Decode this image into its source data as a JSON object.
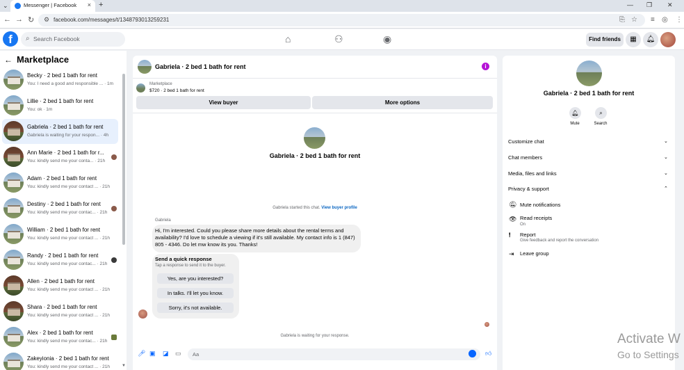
{
  "browser": {
    "tab_title": "Messenger | Facebook",
    "url": "facebook.com/messages/t/1348793013259231"
  },
  "fb_nav": {
    "search_placeholder": "Search Facebook",
    "find_friends": "Find friends"
  },
  "sidebar": {
    "title": "Marketplace",
    "conversations": [
      {
        "name": "Becky · 2 bed 1 bath for rent",
        "preview": "You: I need a good and responsible ...",
        "time": "· 1m"
      },
      {
        "name": "Lillie · 2 bed 1 bath for rent",
        "preview": "You: ok",
        "time": "· 1m"
      },
      {
        "name": "Gabriela · 2 bed 1 bath for rent",
        "preview": "Gabriela is waiting for your respon...",
        "time": "· 4h"
      },
      {
        "name": "Ann Marie · 2 bed 1 bath for r...",
        "preview": "You: kindly send me your conta...",
        "time": "· 21h"
      },
      {
        "name": "Adam · 2 bed 1 bath for rent",
        "preview": "You: kindly send me your contact ...",
        "time": "· 21h"
      },
      {
        "name": "Destiny · 2 bed 1 bath for rent",
        "preview": "You: kindly send me your contac...",
        "time": "· 21h"
      },
      {
        "name": "William · 2 bed 1 bath for rent",
        "preview": "You: kindly send me your contact ...",
        "time": "· 21h"
      },
      {
        "name": "Randy · 2 bed 1 bath for rent",
        "preview": "You: kindly send me your contac...",
        "time": "· 21h"
      },
      {
        "name": "Allen · 2 bed 1 bath for rent",
        "preview": "You: kindly send me your contact ...",
        "time": "· 21h"
      },
      {
        "name": "Shara · 2 bed 1 bath for rent",
        "preview": "You: kindly send me your contact ...",
        "time": "· 21h"
      },
      {
        "name": "Alex · 2 bed 1 bath for rent",
        "preview": "You: kindly send me your contac...",
        "time": "· 21h"
      },
      {
        "name": "Zakeyionia · 2 bed 1 bath for rent",
        "preview": "You: kindly send me your contact ...",
        "time": "· 21h"
      }
    ]
  },
  "chat": {
    "header_title": "Gabriela · 2 bed 1 bath for rent",
    "marketplace_label": "Marketplace",
    "listing": "$720 · 2 bed 1 bath for rent",
    "view_buyer": "View buyer",
    "more_options": "More options",
    "center_title": "Gabriela · 2 bed 1 bath for rent",
    "started_text": "Gabriela started this chat.",
    "view_buyer_profile": "View buyer profile",
    "sender": "Gabriela",
    "message": "Hi, I'm interested. Could you please share more details about the rental terms and availability? I'd love to schedule a viewing if it's still available. My contact info is 1 (847) 805 - 4346. Do let mw know its you. Thanks!",
    "quick_title": "Send a quick response",
    "quick_sub": "Tap a response to send it to the buyer.",
    "quick_replies": [
      "Yes, are you interested?",
      "In talks. I'll let you know.",
      "Sorry, it's not available."
    ],
    "waiting_text": "Gabriela is waiting for your response.",
    "compose_placeholder": "Aa"
  },
  "details": {
    "title": "Gabriela · 2 bed 1 bath for rent",
    "mute_label": "Mute",
    "search_label": "Search",
    "sections": [
      "Customize chat",
      "Chat members",
      "Media, files and links",
      "Privacy & support"
    ],
    "items": [
      {
        "label": "Mute notifications",
        "sub": ""
      },
      {
        "label": "Read receipts",
        "sub": "On"
      },
      {
        "label": "Report",
        "sub": "Give feedback and report the conversation"
      },
      {
        "label": "Leave group",
        "sub": ""
      }
    ]
  },
  "watermark": {
    "line1": "Activate W",
    "line2": "Go to Settings"
  },
  "colors": {
    "brand": "#1877f2",
    "messenger_blue": "#0866ff",
    "info_purple": "#b514d6"
  }
}
